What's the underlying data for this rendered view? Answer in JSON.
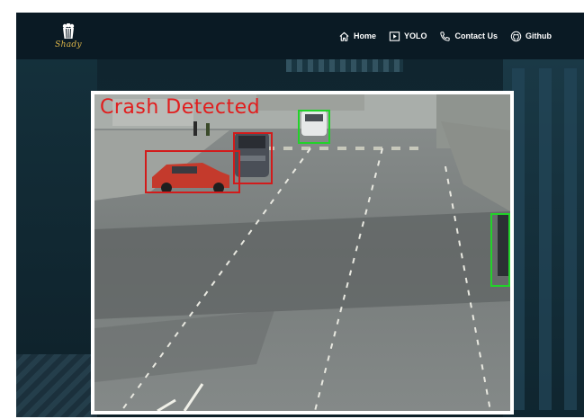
{
  "brand": {
    "logo_text": "Shady"
  },
  "nav": {
    "items": [
      {
        "label": "Home",
        "icon": "home-icon"
      },
      {
        "label": "YOLO",
        "icon": "play-icon"
      },
      {
        "label": "Contact Us",
        "icon": "phone-icon"
      },
      {
        "label": "Github",
        "icon": "github-icon"
      }
    ]
  },
  "video": {
    "overlay_text": "Crash Detected",
    "detections": [
      {
        "label": "crash",
        "color": "#d21b1b"
      },
      {
        "label": "crash",
        "color": "#d21b1b"
      },
      {
        "label": "car",
        "color": "#22d22a"
      },
      {
        "label": "car",
        "color": "#22d22a"
      }
    ]
  },
  "colors": {
    "navbar_bg": "#0a1a24",
    "accent_logo": "#e0b84a",
    "crash_red": "#e11d1d",
    "safe_green": "#22d22a"
  }
}
